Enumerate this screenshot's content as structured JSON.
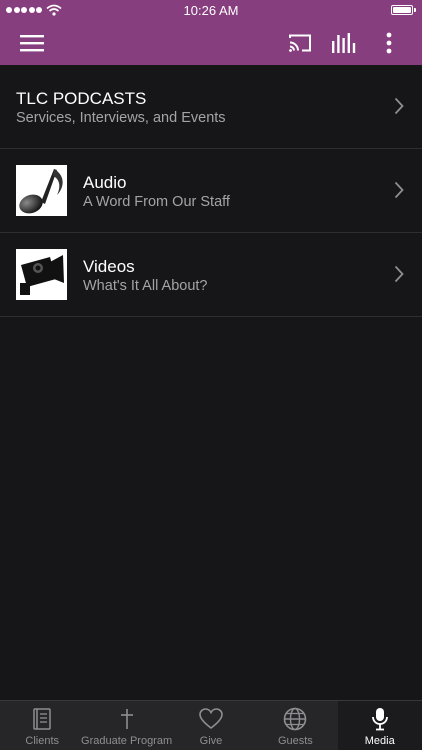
{
  "status_bar": {
    "time": "10:26 AM"
  },
  "toolbar": {
    "icons": [
      "menu-icon",
      "cast-icon",
      "equalizer-icon",
      "more-vertical-icon"
    ],
    "accent_color": "#863e7e"
  },
  "list": {
    "items": [
      {
        "title": "TLC PODCASTS",
        "subtitle": "Services, Interviews, and Events"
      },
      {
        "title": "Audio",
        "subtitle": "A Word From Our Staff",
        "icon": "music-note-icon"
      },
      {
        "title": "Videos",
        "subtitle": "What's It All About?",
        "icon": "video-camera-icon"
      }
    ]
  },
  "tabbar": {
    "active": "Media",
    "tabs": [
      {
        "label": "Clients",
        "icon": "book-icon"
      },
      {
        "label": "Graduate Program",
        "icon": "cross-icon"
      },
      {
        "label": "Give",
        "icon": "heart-icon"
      },
      {
        "label": "Guests",
        "icon": "globe-icon"
      },
      {
        "label": "Media",
        "icon": "microphone-icon"
      }
    ]
  }
}
